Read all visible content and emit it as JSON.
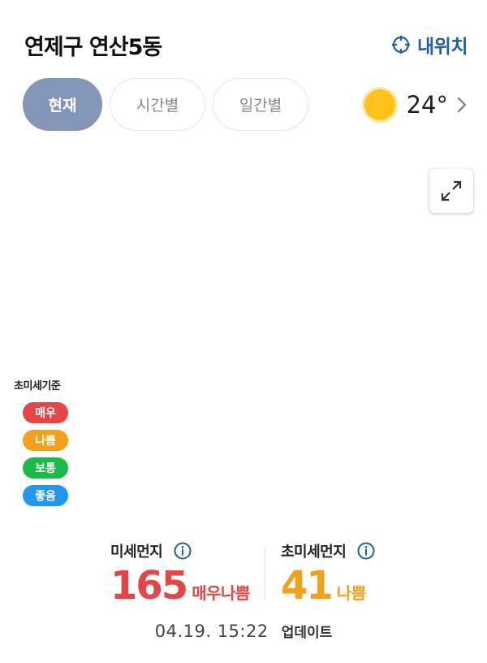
{
  "header": {
    "location": "연제구 연산5동",
    "my_location_label": "내위치"
  },
  "tabs": [
    {
      "label": "현재",
      "active": true
    },
    {
      "label": "시간별",
      "active": false
    },
    {
      "label": "일간별",
      "active": false
    }
  ],
  "weather": {
    "icon": "sun-icon",
    "temperature": "24°"
  },
  "legend": {
    "title": "초미세기준",
    "items": [
      {
        "label": "매우",
        "color": "#e64545"
      },
      {
        "label": "나쁨",
        "color": "#f5a01a"
      },
      {
        "label": "보통",
        "color": "#1aba4a"
      },
      {
        "label": "좋음",
        "color": "#2196f3"
      }
    ]
  },
  "dust": {
    "pm10": {
      "label": "미세먼지",
      "value": "165",
      "grade": "매우나쁨",
      "color": "#e64545"
    },
    "pm25": {
      "label": "초미세먼지",
      "value": "41",
      "grade": "나쁨",
      "color": "#f5a01a"
    }
  },
  "update": {
    "time": "04.19. 15:22",
    "label": "업데이트"
  }
}
